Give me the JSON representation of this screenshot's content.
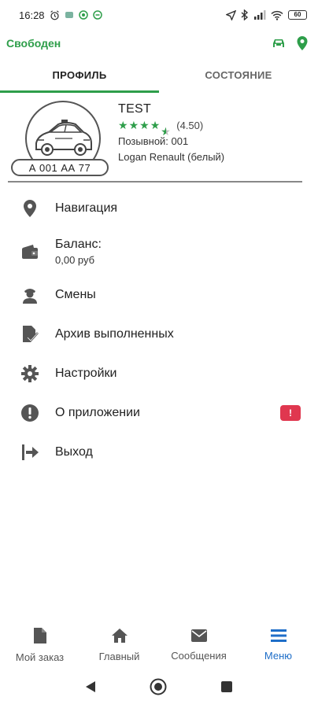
{
  "statusbar": {
    "time": "16:28",
    "battery": "60"
  },
  "appbar": {
    "status": "Свободен",
    "icons": [
      "car-icon",
      "location-pin-icon"
    ]
  },
  "tabs": [
    {
      "label": "ПРОФИЛЬ",
      "active": true
    },
    {
      "label": "СОСТОЯНИЕ",
      "active": false
    }
  ],
  "profile": {
    "name": "TEST",
    "rating": 4.5,
    "rating_text": "(4.50)",
    "callsign": "Позывной: 001",
    "car": "Logan Renault (белый)",
    "plate": "А 001 АА 77"
  },
  "menu": {
    "items": [
      {
        "label": "Навигация",
        "icon": "location-pin-icon"
      },
      {
        "label": "Баланс:",
        "sub": "0,00 руб",
        "icon": "wallet-icon"
      },
      {
        "label": "Смены",
        "icon": "driver-icon"
      },
      {
        "label": "Архив выполненных",
        "icon": "document-check-icon"
      },
      {
        "label": "Настройки",
        "icon": "gear-icon"
      },
      {
        "label": "О приложении",
        "icon": "alert-circle-icon",
        "badge": "!"
      },
      {
        "label": "Выход",
        "icon": "logout-icon"
      }
    ]
  },
  "bottom_nav": [
    {
      "label": "Мой заказ",
      "icon": "document-icon",
      "active": false
    },
    {
      "label": "Главный",
      "icon": "home-icon",
      "active": false
    },
    {
      "label": "Сообщения",
      "icon": "mail-icon",
      "active": false
    },
    {
      "label": "Меню",
      "icon": "menu-icon",
      "active": true
    }
  ],
  "colors": {
    "accent_green": "#2e9e4a",
    "active_blue": "#1e6ec8",
    "badge_red": "#e0374f",
    "icon_gray": "#555555"
  }
}
